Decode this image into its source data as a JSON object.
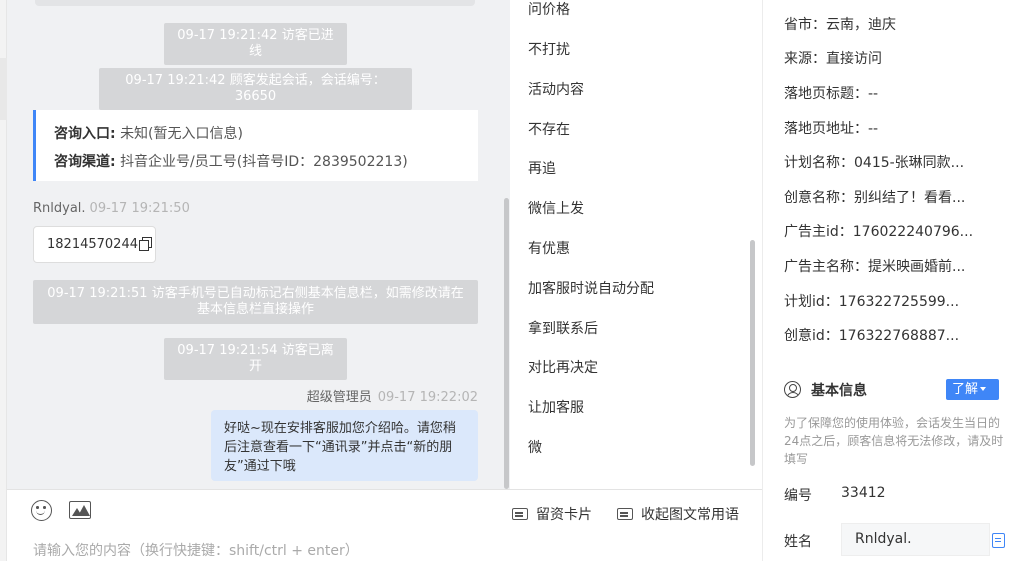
{
  "chat": {
    "sys_msgs": [
      "09-17 19:21:42 访客已进线",
      "09-17 19:21:42 顾客发起会话，会话编号：36650",
      "09-17 19:21:51 访客手机号已自动标记右侧基本信息栏，如需修改请在基本信息栏直接操作",
      "09-17 19:21:54 访客已离开"
    ],
    "info_card": {
      "entry_label": "咨询入口:",
      "entry_value": "未知(暂无入口信息)",
      "channel_label": "咨询渠道:",
      "channel_value": "抖音企业号/员工号(抖音号ID：2839502213)"
    },
    "visitor": {
      "name": "Rnldyal.",
      "time": "09-17 19:21:50",
      "phone": "18214570244"
    },
    "agent": {
      "name": "超级管理员",
      "time": "09-17 19:22:02",
      "message": "好哒~现在安排客服加您介绍哈。请您稍后注意查看一下“通讯录”并点击“新的朋友”通过下哦"
    }
  },
  "input": {
    "placeholder": "请输入您的内容（换行快捷键：shift/ctrl + enter）",
    "card_label": "留资卡片",
    "phrases_label": "收起图文常用语"
  },
  "phrases": [
    "问价格",
    "不打扰",
    "活动内容",
    "不存在",
    "再追",
    "微信上发",
    "有优惠",
    "加客服时说自动分配",
    "拿到联系后",
    "对比再决定",
    "让加客服",
    "微"
  ],
  "info": [
    "省市：云南，迪庆",
    "来源：直接访问",
    "落地页标题：--",
    "落地页地址：--",
    "计划名称：0415-张琳同款...",
    "创意名称：别纠结了！看看...",
    "广告主id：176022240796...",
    "广告主名称：提米映画婚前...",
    "计划id：176322725599...",
    "创意id：176322768887..."
  ],
  "basic": {
    "title": "基本信息",
    "learn_btn": "了解",
    "notice": "为了保障您的使用体验，会话发生当日的24点之后，顾客信息将无法修改，请及时填写",
    "id_label": "编号",
    "id_value": "33412",
    "name_label": "姓名",
    "name_value": "Rnldyal."
  }
}
